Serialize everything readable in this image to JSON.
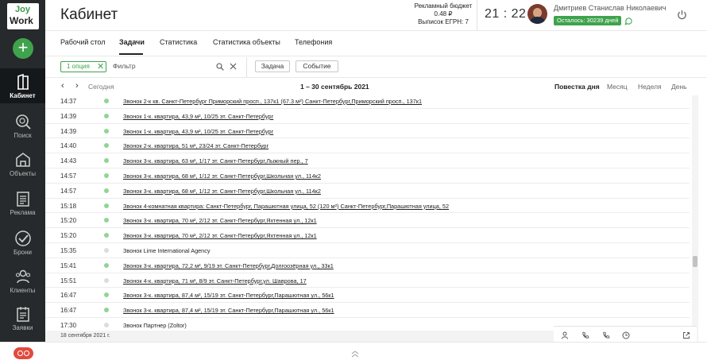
{
  "app": {
    "logo_line1": "Joy",
    "logo_line2": "Work",
    "add_label": "+"
  },
  "sidebar": {
    "items": [
      {
        "label": "Кабинет",
        "icon": "cabinet-icon"
      },
      {
        "label": "Поиск",
        "icon": "search-icon"
      },
      {
        "label": "Объекты",
        "icon": "objects-icon"
      },
      {
        "label": "Реклама",
        "icon": "advertising-icon"
      },
      {
        "label": "Брони",
        "icon": "booking-icon"
      },
      {
        "label": "Клиенты",
        "icon": "clients-icon"
      },
      {
        "label": "Заявки",
        "icon": "requests-icon"
      }
    ]
  },
  "header": {
    "title": "Кабинет",
    "budget_label": "Рекламный бюджет",
    "budget_value": "0.48 ₽",
    "egrn": "Выписок ЕГРН: 7",
    "clock": "21 : 22",
    "user_name": "Дмитриев Станислав Николаевич",
    "remaining": "Осталось: 30239 дней"
  },
  "tabs": [
    {
      "label": "Рабочий стол"
    },
    {
      "label": "Задачи"
    },
    {
      "label": "Статистика"
    },
    {
      "label": "Статистика объекты"
    },
    {
      "label": "Телефония"
    }
  ],
  "filter": {
    "chip": "1 опция",
    "placeholder": "Фильтр",
    "task_button": "Задача",
    "event_button": "Событие"
  },
  "calendar": {
    "prev": "‹",
    "next": "›",
    "today": "Сегодня",
    "range": "1 – 30 сентябрь 2021",
    "views": [
      "Повестка дня",
      "Месяц",
      "Неделя",
      "День"
    ]
  },
  "events": [
    {
      "time": "14:37",
      "title": "Звонок 2-к кв. Санкт-Петербург Приморский просп., 137к1 (67.3 м²) Санкт-Петербург,Приморский просп., 137к1",
      "status": "green"
    },
    {
      "time": "14:39",
      "title": "Звонок 1-к. квартира, 43,9 м², 10/25 эт. Санкт-Петербург",
      "status": "green"
    },
    {
      "time": "14:39",
      "title": "Звонок 1-к. квартира, 43,9 м², 10/25 эт. Санкт-Петербург",
      "status": "green"
    },
    {
      "time": "14:40",
      "title": "Звонок 2-к. квартира, 51 м², 23/24 эт. Санкт-Петербург",
      "status": "green"
    },
    {
      "time": "14:43",
      "title": "Звонок 3-к. квартира, 63 м², 1/17 эт. Санкт-Петербург,Лыжный пер., 7",
      "status": "green"
    },
    {
      "time": "14:57",
      "title": "Звонок 3-к. квартира, 68 м², 1/12 эт. Санкт-Петербург,Школьная ул., 114к2",
      "status": "green"
    },
    {
      "time": "14:57",
      "title": "Звонок 3-к. квартира, 68 м², 1/12 эт. Санкт-Петербург,Школьная ул., 114к2",
      "status": "green"
    },
    {
      "time": "15:18",
      "title": "Звонок 4-комнатная квартира: Санкт-Петербург, Парашютная улица, 52 (120 м²) Санкт-Петербург,Парашютная улица, 52",
      "status": "green"
    },
    {
      "time": "15:20",
      "title": "Звонок 3-к. квартира, 70 м², 2/12 эт. Санкт-Петербург,Яхтенная ул., 12к1",
      "status": "green"
    },
    {
      "time": "15:20",
      "title": "Звонок 3-к. квартира, 70 м², 2/12 эт. Санкт-Петербург,Яхтенная ул., 12к1",
      "status": "green"
    },
    {
      "time": "15:35",
      "title": "Звонок Lime International Agency",
      "status": "grey"
    },
    {
      "time": "15:41",
      "title": "Звонок 3-к. квартира, 72,2 м², 9/19 эт. Санкт-Петербург,Долгоозёрная ул., 33к1",
      "status": "green"
    },
    {
      "time": "15:51",
      "title": "Звонок 4-к. квартира, 71 м², 8/9 эт. Санкт-Петербург,ул. Шаврова, 17",
      "status": "grey"
    },
    {
      "time": "16:47",
      "title": "Звонок 3-к. квартира, 87,4 м², 15/19 эт. Санкт-Петербург,Парашютная ул., 56к1",
      "status": "green"
    },
    {
      "time": "16:47",
      "title": "Звонок 3-к. квартира, 87,4 м², 15/19 эт. Санкт-Петербург,Парашютная ул., 56к1",
      "status": "green"
    },
    {
      "time": "17:30",
      "title": "Звонок Партнер (Zoltor)",
      "status": "grey"
    }
  ],
  "footer_date": "18 сентября 2021 г.",
  "colors": {
    "accent": "#3fa34d",
    "sidebar": "#262a2c",
    "dot_green": "#8fd694",
    "dot_grey": "#dcdcdc"
  }
}
